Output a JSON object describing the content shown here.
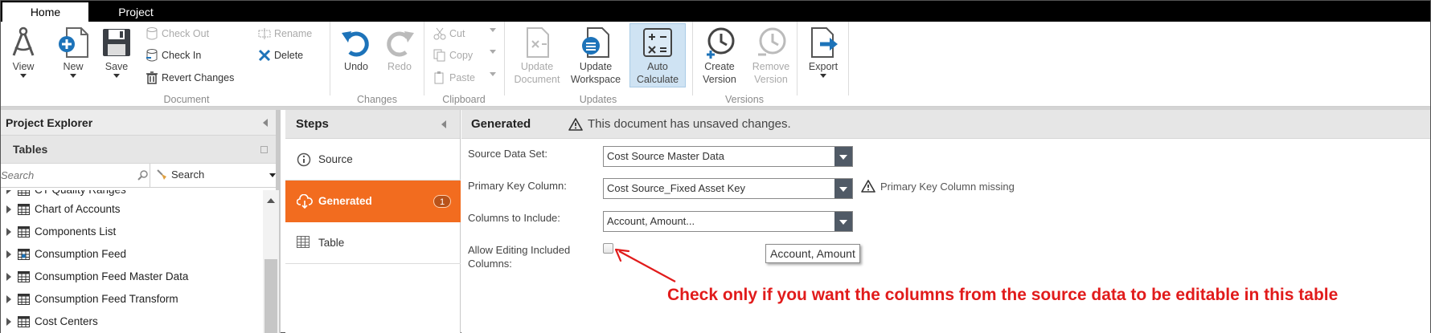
{
  "tabs": {
    "home": "Home",
    "project": "Project"
  },
  "ribbon": {
    "view": "View",
    "new": "New",
    "save": "Save",
    "check_out": "Check Out",
    "check_in": "Check In",
    "revert_changes": "Revert Changes",
    "rename": "Rename",
    "delete": "Delete",
    "undo": "Undo",
    "redo": "Redo",
    "cut": "Cut",
    "copy": "Copy",
    "paste": "Paste",
    "update_document": [
      "Update",
      "Document"
    ],
    "update_workspace": [
      "Update",
      "Workspace"
    ],
    "auto_calculate": [
      "Auto",
      "Calculate"
    ],
    "create_version": [
      "Create",
      "Version"
    ],
    "remove_version": [
      "Remove",
      "Version"
    ],
    "export": "Export",
    "groups": {
      "document": "Document",
      "changes": "Changes",
      "clipboard": "Clipboard",
      "updates": "Updates",
      "versions": "Versions"
    }
  },
  "explorer": {
    "title": "Project Explorer",
    "tables_title": "Tables",
    "search_placeholder": "Search",
    "search_button": "Search",
    "items": [
      "CT Quality Ranges",
      "Chart of Accounts",
      "Components List",
      "Consumption Feed",
      "Consumption Feed Master Data",
      "Consumption Feed Transform",
      "Cost Centers"
    ]
  },
  "steps": {
    "title": "Steps",
    "items": [
      {
        "label": "Source"
      },
      {
        "label": "Generated",
        "badge": "1"
      },
      {
        "label": "Table"
      }
    ]
  },
  "main": {
    "title": "Generated",
    "warning": "This document has unsaved changes.",
    "fields": {
      "source_label": "Source Data Set:",
      "source_value": "Cost Source Master Data",
      "pk_label": "Primary Key Column:",
      "pk_value": "Cost Source_Fixed Asset Key",
      "pk_warning": "Primary Key Column missing",
      "cols_label": "Columns to Include:",
      "cols_value": "Account, Amount...",
      "allow_label_1": "Allow Editing Included",
      "allow_label_2": "Columns:",
      "tooltip": "Account, Amount"
    },
    "annotation": "Check only if you want the columns from the source data to be editable in this table"
  },
  "colors": {
    "accent": "#f26c1f",
    "annotation": "#e11b1b",
    "dropdown": "#505a66"
  }
}
